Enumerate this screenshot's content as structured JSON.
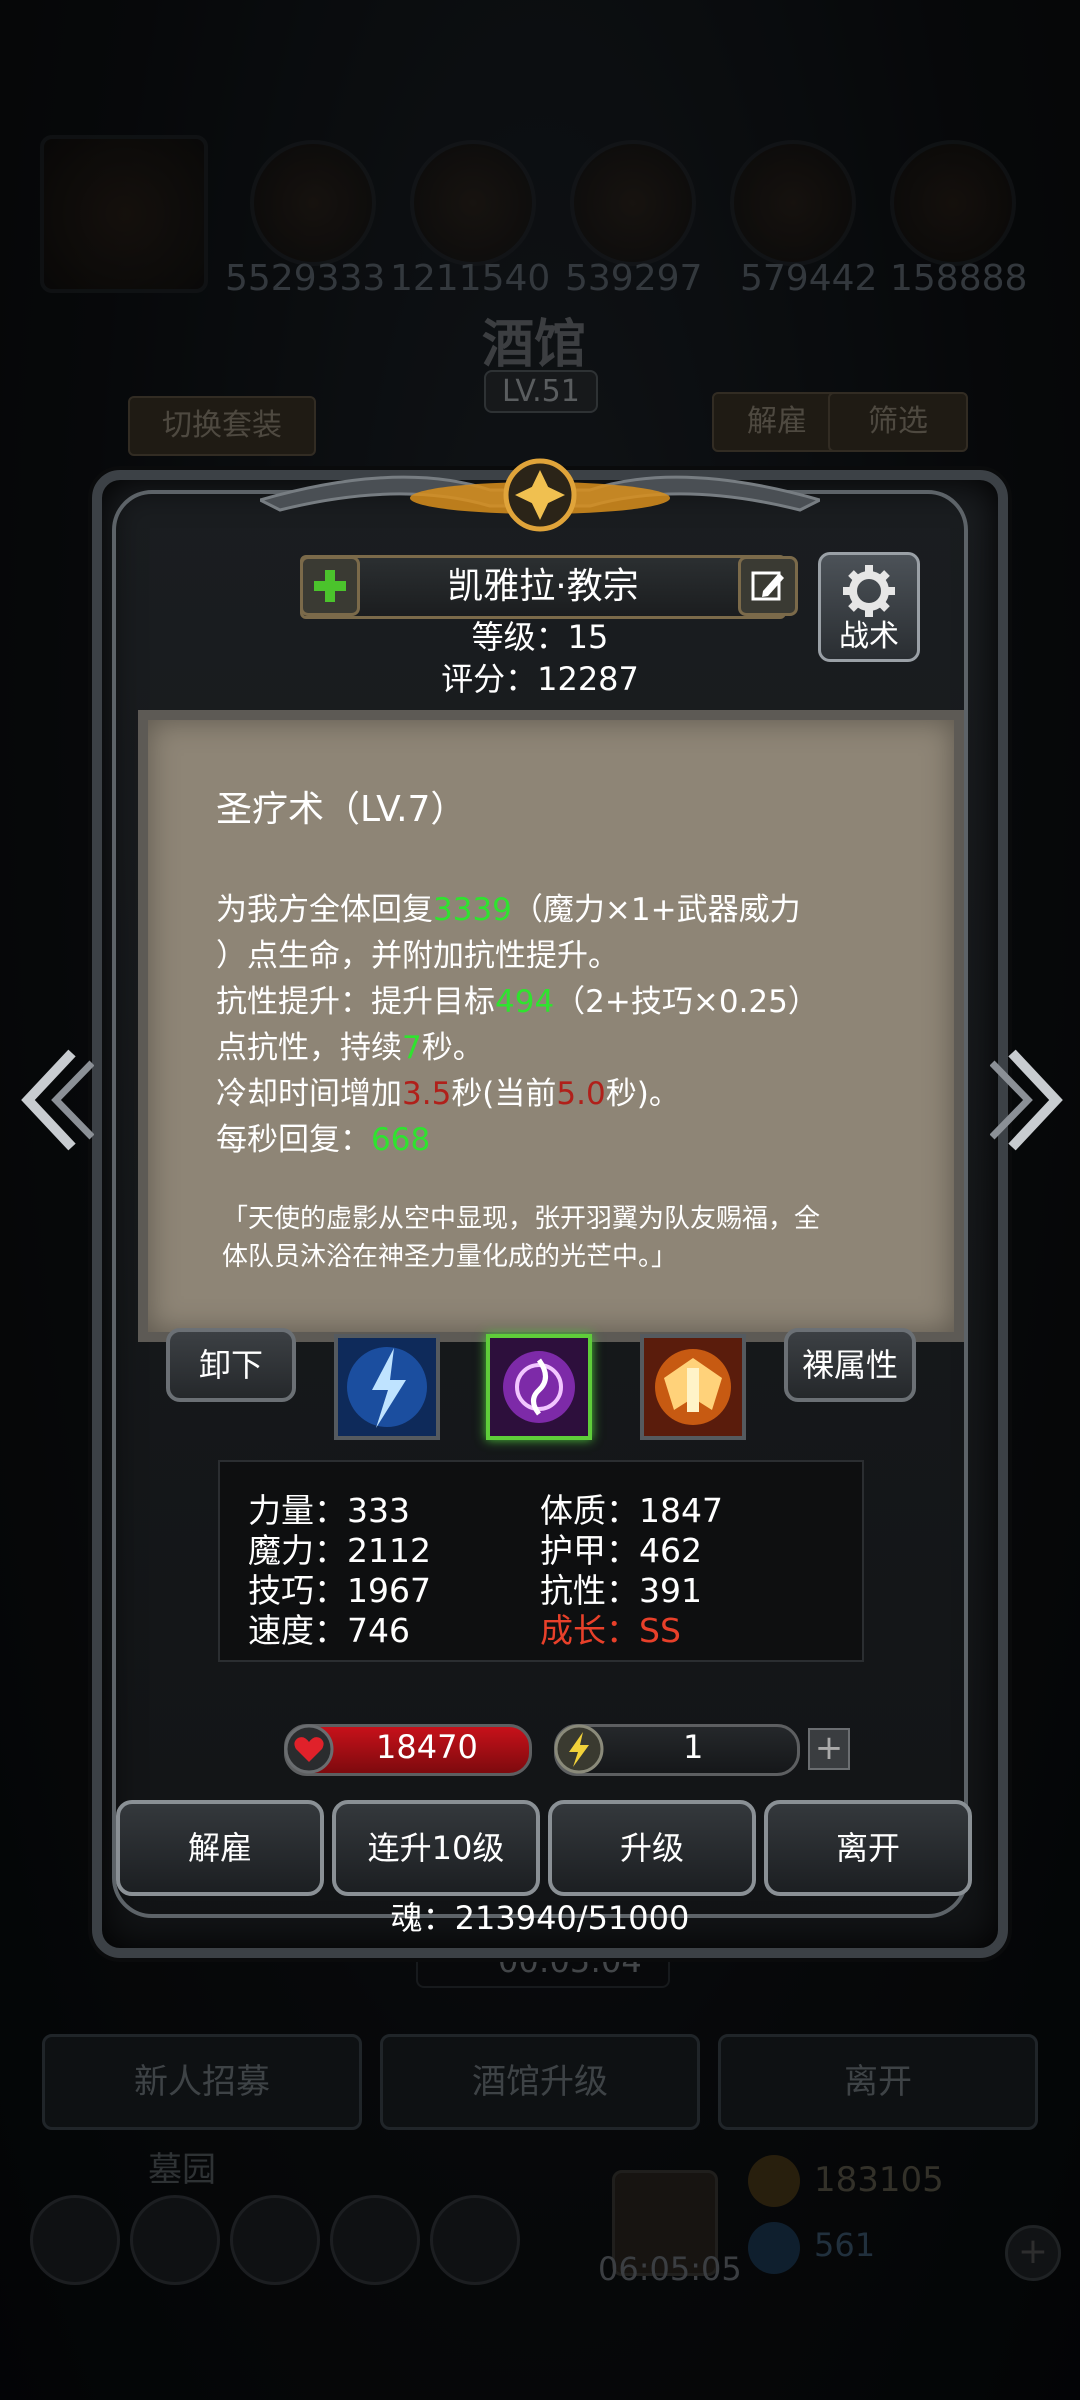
{
  "background": {
    "resources": [
      "5529333",
      "1211540",
      "539297",
      "579442",
      "158888"
    ],
    "title": "酒馆",
    "level": "LV.51",
    "switch_outfit": "切换套装",
    "dismiss": "解雇",
    "filter": "筛选",
    "timer": "00:05:04",
    "bottom_buttons": [
      "新人招募",
      "酒馆升级",
      "离开"
    ],
    "cemetery": "墓园",
    "gold": "183105",
    "gems": "561",
    "bottom_timer": "06:05:05"
  },
  "hero": {
    "name": "凯雅拉·教宗",
    "level_line": "等级：15",
    "score_line": "评分：12287",
    "tactics_label": "战术"
  },
  "skill_desc": {
    "title": "圣疗术（LV.7）",
    "line1_a": "为我方全体回复",
    "heal": "3339",
    "line1_b": "（魔力×1+武器威力",
    "line2": "）点生命，并附加抗性提升。",
    "line3_a": "抗性提升：提升目标",
    "res_value": "494",
    "line3_b": "（2+技巧×0.25）",
    "line4_a": "点抗性，持续",
    "duration": "7",
    "line4_b": "秒。",
    "line5_a": "冷却时间增加",
    "cd_add": "3.5",
    "line5_b": "秒(当前",
    "cd_now": "5.0",
    "line5_c": "秒)。",
    "line6_a": "每秒回复：",
    "per_sec": "668",
    "flavor1": "「天使的虚影从空中显现，张开羽翼为队友赐福，全",
    "flavor2": "体队员沐浴在神圣力量化成的光芒中。」"
  },
  "skill_row": {
    "unequip": "卸下",
    "base_attr": "裸属性",
    "skills": [
      "lightning-skill-icon",
      "holy-heal-skill-icon",
      "angel-wings-skill-icon"
    ]
  },
  "attributes": {
    "strength": "力量：333",
    "magic": "魔力：2112",
    "skill": "技巧：1967",
    "speed": "速度：746",
    "constitution": "体质：1847",
    "armor": "护甲：462",
    "resist": "抗性：391",
    "growth": "成长：SS"
  },
  "bars": {
    "hp": "18470",
    "energy": "1",
    "plus": "+"
  },
  "actions": [
    "解雇",
    "连升10级",
    "升级",
    "离开"
  ],
  "soul": "魂：213940/51000",
  "colors": {
    "green_value": "#2fe32f",
    "red_value": "#b0201a",
    "growth": "#e8402a"
  }
}
